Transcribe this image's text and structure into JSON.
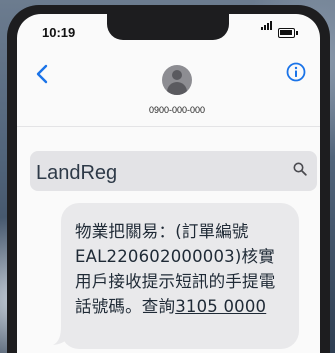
{
  "status_bar": {
    "time": "10:19"
  },
  "header": {
    "contact_number": "0900-000-000"
  },
  "icons": {
    "back": "chevron-left-icon",
    "info": "info-icon",
    "search": "search-icon",
    "avatar": "person-icon"
  },
  "search": {
    "query": "LandReg"
  },
  "message": {
    "body": "物業把關易：(訂單編號\nEAL220602000003)核實\n用戶接收提示短訊的手提電\n話號碼。查詢",
    "link_text": "3105 0000"
  },
  "colors": {
    "accent": "#1a73e8",
    "bubble": "#e9e9eb",
    "search_bg": "#e3e3e6"
  }
}
